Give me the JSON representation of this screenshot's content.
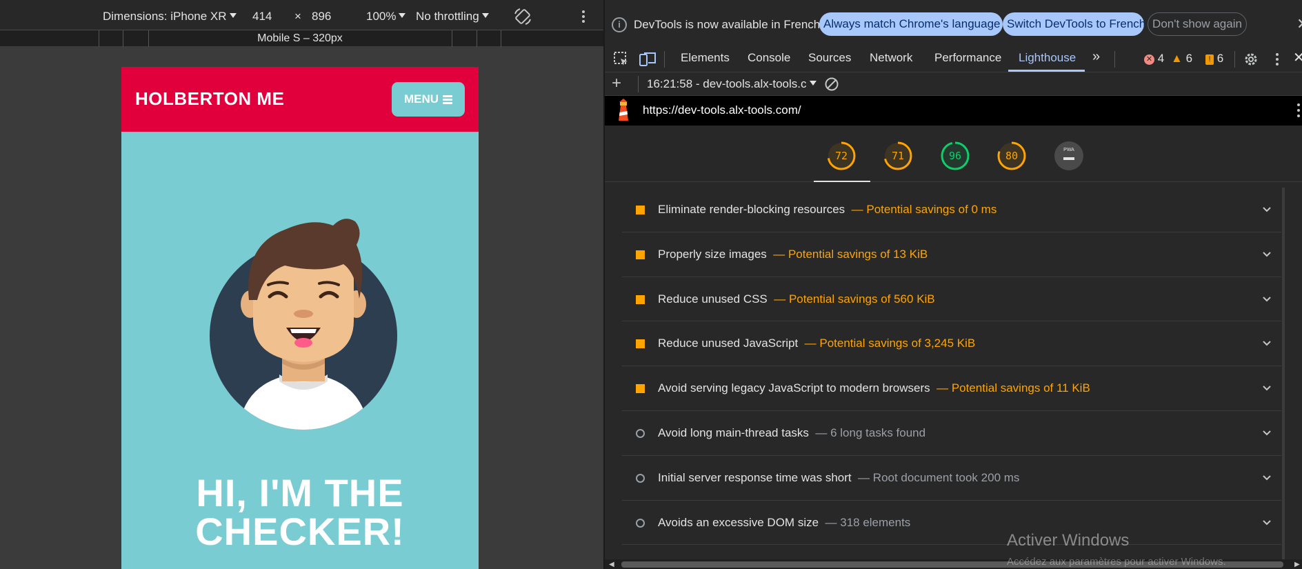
{
  "device_toolbar": {
    "dimensions_label": "Dimensions: iPhone XR",
    "width": "414",
    "times": "×",
    "height": "896",
    "zoom": "100%",
    "throttling": "No throttling"
  },
  "media_bar": {
    "label": "Mobile S – 320px"
  },
  "page": {
    "brand": "HOLBERTON ME",
    "menu_label": "MENU",
    "hero_line1": "HI, I'M THE",
    "hero_line2": "CHECKER!",
    "colors": {
      "header": "#e1003b",
      "body": "#79cdd2"
    }
  },
  "infobar": {
    "message": "DevTools is now available in French!",
    "btn_match": "Always match Chrome's language",
    "btn_switch": "Switch DevTools to French",
    "btn_dismiss": "Don't show again"
  },
  "tabs": [
    {
      "label": "Elements"
    },
    {
      "label": "Console"
    },
    {
      "label": "Sources"
    },
    {
      "label": "Network"
    },
    {
      "label": "Performance"
    },
    {
      "label": "Lighthouse",
      "active": true
    }
  ],
  "badges": {
    "errors": "4",
    "warnings": "6",
    "issues": "6"
  },
  "report_bar": {
    "report": "16:21:58 - dev-tools.alx-tools.c"
  },
  "url_bar": {
    "url": "https://dev-tools.alx-tools.com/"
  },
  "scores": [
    {
      "value": "72",
      "color": "#ffa400"
    },
    {
      "value": "71",
      "color": "#ffa400"
    },
    {
      "value": "96",
      "color": "#0cce6b"
    },
    {
      "value": "80",
      "color": "#ffa400"
    },
    {
      "value": "PWA",
      "color": "#9aa0a6"
    }
  ],
  "audits": [
    {
      "title": "Eliminate render-blocking resources",
      "detail": "— Potential savings of 0 ms",
      "kind": "warn"
    },
    {
      "title": "Properly size images",
      "detail": "— Potential savings of 13 KiB",
      "kind": "warn"
    },
    {
      "title": "Reduce unused CSS",
      "detail": "— Potential savings of 560 KiB",
      "kind": "warn"
    },
    {
      "title": "Reduce unused JavaScript",
      "detail": "— Potential savings of 3,245 KiB",
      "kind": "warn"
    },
    {
      "title": "Avoid serving legacy JavaScript to modern browsers",
      "detail": "— Potential savings of 11 KiB",
      "kind": "warn"
    },
    {
      "title": "Avoid long main-thread tasks",
      "detail": "— 6 long tasks found",
      "kind": "info"
    },
    {
      "title": "Initial server response time was short",
      "detail": "— Root document took 200 ms",
      "kind": "info"
    },
    {
      "title": "Avoids an excessive DOM size",
      "detail": "— 318 elements",
      "kind": "info"
    }
  ],
  "watermark": {
    "title": "Activer Windows",
    "subtitle": "Accédez aux paramètres pour activer Windows."
  }
}
